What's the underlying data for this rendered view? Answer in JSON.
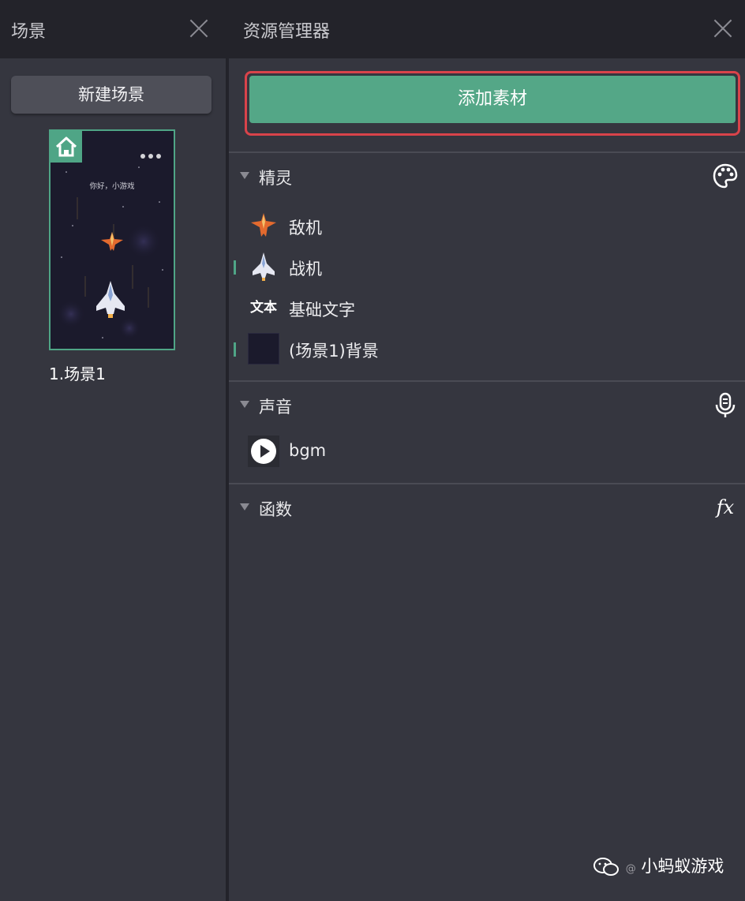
{
  "left_panel": {
    "title": "场景",
    "new_scene_button": "新建场景",
    "scenes": [
      {
        "label": "1.场景1",
        "thumbnail_caption": "你好，小游戏",
        "is_home": true
      }
    ]
  },
  "right_panel": {
    "title": "资源管理器",
    "add_asset_button": "添加素材",
    "sections": {
      "sprites": {
        "title": "精灵",
        "icon": "palette-icon",
        "items": [
          {
            "name": "敌机",
            "thumb": "enemy-plane-icon",
            "selected": false
          },
          {
            "name": "战机",
            "thumb": "fighter-plane-icon",
            "selected": true
          },
          {
            "name": "基础文字",
            "thumb": "text-icon",
            "thumb_text": "文本",
            "selected": false
          },
          {
            "name": "(场景1)背景",
            "thumb": "background-thumbnail",
            "selected": true
          }
        ]
      },
      "sounds": {
        "title": "声音",
        "icon": "microphone-icon",
        "items": [
          {
            "name": "bgm",
            "thumb": "play-icon"
          }
        ]
      },
      "functions": {
        "title": "函数",
        "icon": "fx-icon",
        "icon_text": "fx"
      }
    }
  },
  "watermark": {
    "prefix": "@",
    "text": "小蚂蚁游戏"
  },
  "colors": {
    "accent_green": "#54a787",
    "highlight_red": "#d9434a",
    "panel_bg": "#35363f",
    "header_bg": "#23232a"
  }
}
